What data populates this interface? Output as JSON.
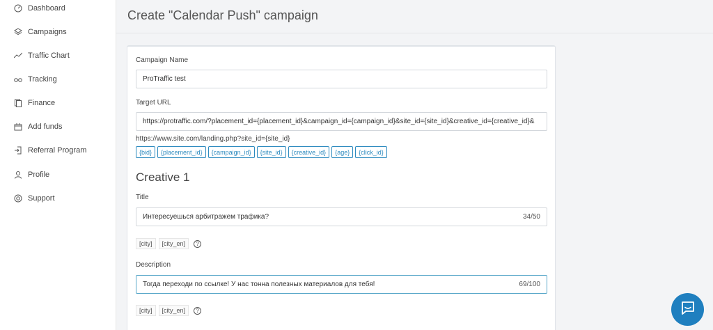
{
  "sidebar": {
    "items": [
      {
        "label": "Dashboard",
        "icon": "dashboard-icon"
      },
      {
        "label": "Campaigns",
        "icon": "layers-icon"
      },
      {
        "label": "Traffic Chart",
        "icon": "chart-line-icon"
      },
      {
        "label": "Tracking",
        "icon": "glasses-icon"
      },
      {
        "label": "Finance",
        "icon": "documents-icon"
      },
      {
        "label": "Add funds",
        "icon": "wallet-icon"
      },
      {
        "label": "Referral Program",
        "icon": "exit-icon"
      },
      {
        "label": "Profile",
        "icon": "user-icon"
      },
      {
        "label": "Support",
        "icon": "lifebuoy-icon"
      }
    ]
  },
  "header": {
    "title": "Create \"Calendar Push\" campaign"
  },
  "form": {
    "campaign_name": {
      "label": "Campaign Name",
      "value": "ProTraffic test"
    },
    "target_url": {
      "label": "Target URL",
      "value": "https://protraffic.com/?placement_id={placement_id}&campaign_id={campaign_id}&site_id={site_id}&creative_id={creative_id}&",
      "hint": "https://www.site.com/landing.php?site_id={site_id}",
      "macros": [
        "{bid}",
        "{placement_id}",
        "{campaign_id}",
        "{site_id}",
        "{creative_id}",
        "{age}",
        "{click_id}"
      ]
    },
    "creative": {
      "heading": "Creative 1",
      "title": {
        "label": "Title",
        "value": "Интересуешься арбитражем трафика?",
        "counter": "34/50"
      },
      "title_vars": [
        "[city]",
        "[city_en]"
      ],
      "description": {
        "label": "Description",
        "value": "Тогда переходи по ссылке!  У нас тонна полезных материалов для тебя!",
        "counter": "69/100"
      },
      "description_vars": [
        "[city]",
        "[city_en]"
      ],
      "help_glyph": "?"
    }
  },
  "colors": {
    "accent": "#2d8bbf",
    "chat": "#1f7fbf",
    "focus": "#5aa8c9"
  }
}
